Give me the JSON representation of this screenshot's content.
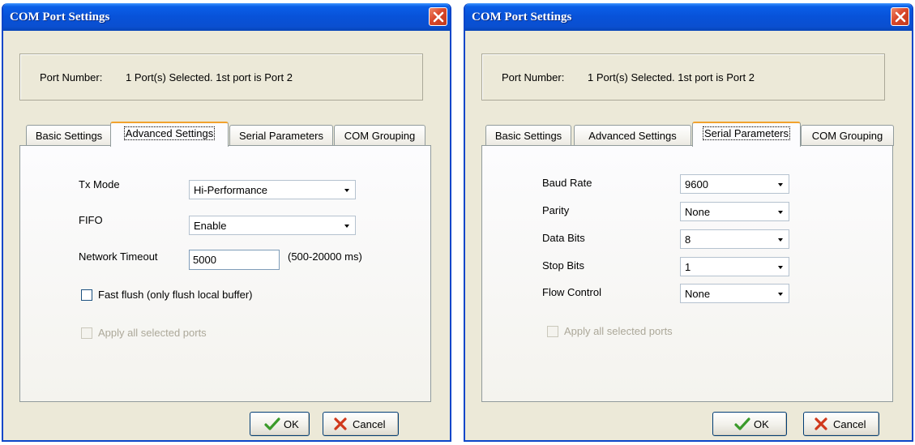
{
  "left_dialog": {
    "title": "COM Port Settings",
    "port": {
      "label": "Port Number:",
      "value": "1 Port(s) Selected. 1st port is Port 2"
    },
    "tabs": [
      "Basic Settings",
      "Advanced Settings",
      "Serial Parameters",
      "COM Grouping"
    ],
    "active_tab": "Advanced Settings",
    "fields": {
      "tx_mode": {
        "label": "Tx Mode",
        "value": "Hi-Performance"
      },
      "fifo": {
        "label": "FIFO",
        "value": "Enable"
      },
      "network_timeout": {
        "label": "Network Timeout",
        "value": "5000",
        "hint": "(500-20000 ms)"
      }
    },
    "fast_flush": {
      "label": "Fast flush (only flush local buffer)",
      "checked": false
    },
    "apply_all": {
      "label": "Apply all selected ports",
      "checked": false,
      "disabled": true
    },
    "ok_label": "OK",
    "cancel_label": "Cancel"
  },
  "right_dialog": {
    "title": "COM Port Settings",
    "port": {
      "label": "Port Number:",
      "value": "1 Port(s) Selected. 1st port is Port 2"
    },
    "tabs": [
      "Basic Settings",
      "Advanced Settings",
      "Serial Parameters",
      "COM Grouping"
    ],
    "active_tab": "Serial Parameters",
    "fields": {
      "baud_rate": {
        "label": "Baud Rate",
        "value": "9600"
      },
      "parity": {
        "label": "Parity",
        "value": "None"
      },
      "data_bits": {
        "label": "Data Bits",
        "value": "8"
      },
      "stop_bits": {
        "label": "Stop Bits",
        "value": "1"
      },
      "flow_control": {
        "label": "Flow Control",
        "value": "None"
      }
    },
    "apply_all": {
      "label": "Apply all selected ports",
      "checked": false,
      "disabled": true
    },
    "ok_label": "OK",
    "cancel_label": "Cancel"
  },
  "colors": {
    "titlebar": "#0a5fe8",
    "dialog_bg": "#ece9d8",
    "active_tab_accent": "#f1a22d",
    "close_button": "#d9472a",
    "ok_check": "#3a9a2a",
    "cancel_x": "#d0381c"
  }
}
